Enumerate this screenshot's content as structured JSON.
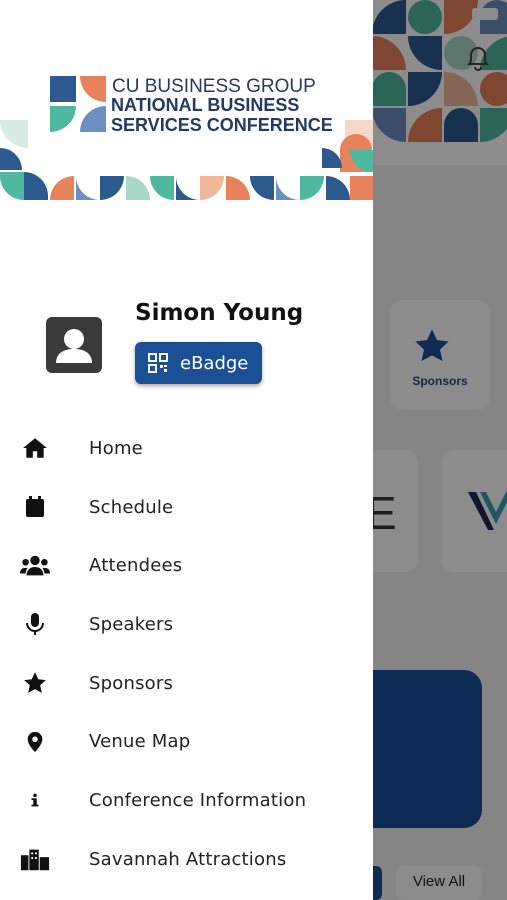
{
  "conference": {
    "line1": "CU BUSINESS GROUP",
    "line2": "NATIONAL BUSINESS",
    "line3": "SERVICES CONFERENCE"
  },
  "profile": {
    "name": "Simon Young",
    "badge_label": "eBadge"
  },
  "menu": [
    {
      "label": "Home",
      "icon": "home-icon"
    },
    {
      "label": "Schedule",
      "icon": "calendar-icon"
    },
    {
      "label": "Attendees",
      "icon": "users-icon"
    },
    {
      "label": "Speakers",
      "icon": "microphone-icon"
    },
    {
      "label": "Sponsors",
      "icon": "star-icon"
    },
    {
      "label": "Venue Map",
      "icon": "map-pin-icon"
    },
    {
      "label": "Conference Information",
      "icon": "info-icon"
    },
    {
      "label": "Savannah Attractions",
      "icon": "city-icon"
    }
  ],
  "background": {
    "sponsors_label": "Sponsors",
    "view_all_label": "View All"
  },
  "colors": {
    "primary": "#1b4f96",
    "navy_text": "#243a5e",
    "pattern": [
      "#2c5a8f",
      "#e8825a",
      "#4fb99f",
      "#a9d8c8",
      "#6a8fc0",
      "#f2b89a"
    ]
  }
}
